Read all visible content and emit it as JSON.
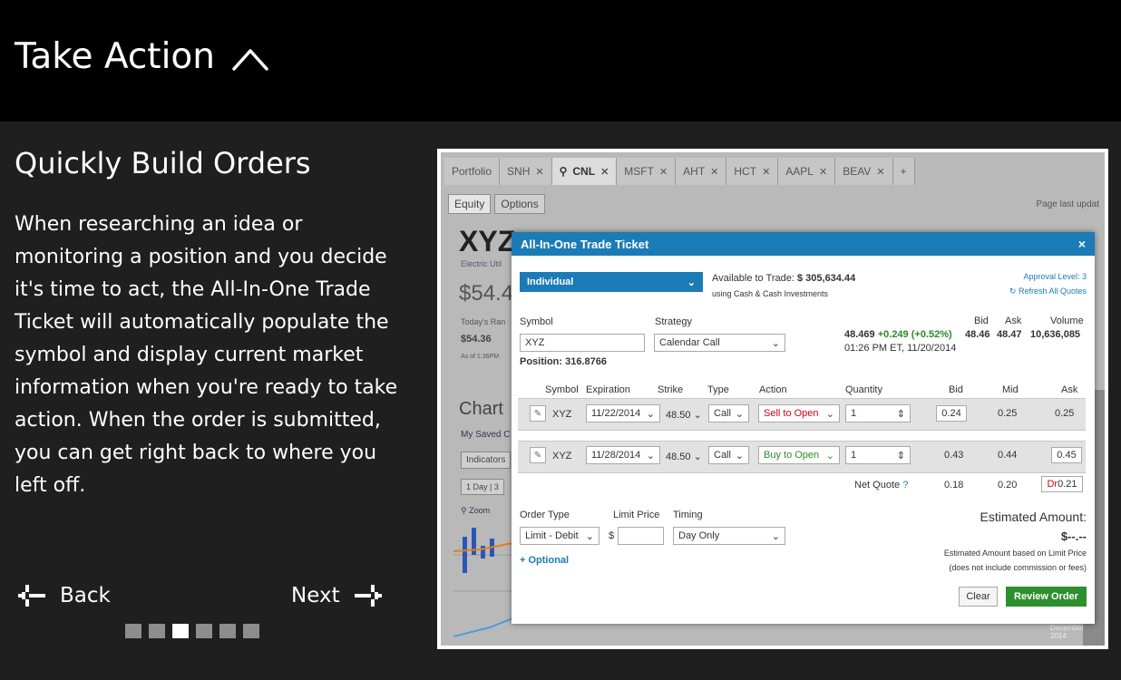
{
  "header": {
    "title": "Take Action"
  },
  "section": {
    "title": "Quickly Build Orders",
    "body": "When researching an idea or monitoring a position and you decide it's time to act, the All-In-One Trade Ticket will automatically populate the symbol and display current market information when you're ready to take action. When the order is submitted, you can get right back to where you left off."
  },
  "nav": {
    "back": "Back",
    "next": "Next",
    "page_count": 6,
    "current_page": 3
  },
  "background": {
    "tabs": [
      {
        "label": "Portfolio"
      },
      {
        "label": "SNH"
      },
      {
        "label": "CNL"
      },
      {
        "label": "MSFT"
      },
      {
        "label": "AHT"
      },
      {
        "label": "HCT"
      },
      {
        "label": "AAPL"
      },
      {
        "label": "BEAV"
      }
    ],
    "sub_tabs": [
      "Equity",
      "Options"
    ],
    "page_updated": "Page last updat",
    "symbol": "XYZ",
    "util_label": "Electric Util",
    "price": "$54.4",
    "today_label": "Today's Ran",
    "today_value": "$54.36",
    "as_of": "As of 1:36PM",
    "chart_label": "Chart",
    "my_saved": "My Saved C",
    "indicators": "Indicators",
    "one_day": "1 Day",
    "three": "3",
    "zoom": "Zoom",
    "december": "December",
    "year": "2014"
  },
  "ticket": {
    "title": "All-In-One Trade Ticket",
    "close": "×",
    "account": "Individual",
    "available_label": "Available to Trade:",
    "available_value": "$ 305,634.44",
    "using": "using Cash & Cash Investments",
    "approval": "Approval Level: 3",
    "refresh": "Refresh All Quotes",
    "symbol_label": "Symbol",
    "symbol_value": "XYZ",
    "position": "Position: 316.8766",
    "strategy_label": "Strategy",
    "strategy_value": "Calendar Call",
    "quote": {
      "last": "48.469",
      "change": "+0.249 (+0.52%)",
      "time": "01:26 PM ET, 11/20/2014",
      "bid_label": "Bid",
      "ask_label": "Ask",
      "volume_label": "Volume",
      "bid": "48.46",
      "ask": "48.47",
      "volume": "10,636,085"
    },
    "columns": [
      "Symbol",
      "Expiration",
      "Strike",
      "Type",
      "Action",
      "Quantity",
      "Bid",
      "Mid",
      "Ask"
    ],
    "legs": [
      {
        "symbol": "XYZ",
        "expiration": "11/22/2014",
        "strike": "48.50",
        "type": "Call",
        "action": "Sell to Open",
        "quantity": "1",
        "bid": "0.24",
        "mid": "0.25",
        "ask": "0.25"
      },
      {
        "symbol": "XYZ",
        "expiration": "11/28/2014",
        "strike": "48.50",
        "type": "Call",
        "action": "Buy to Open",
        "quantity": "1",
        "bid": "0.43",
        "mid": "0.44",
        "ask": "0.45"
      }
    ],
    "net_quote_label": "Net Quote",
    "net_bid": "0.18",
    "net_mid": "0.20",
    "net_ask_prefix": "Dr",
    "net_ask": "0.21",
    "order_type_label": "Order Type",
    "order_type_value": "Limit - Debit",
    "limit_price_label": "Limit Price",
    "dollar": "$",
    "timing_label": "Timing",
    "timing_value": "Day Only",
    "optional": "+ Optional",
    "estimated_label": "Estimated Amount:",
    "estimated_value": "$--.--",
    "estimated_note1": "Estimated Amount based on Limit Price",
    "estimated_note2": "(does not include commission or fees)",
    "clear": "Clear",
    "review": "Review Order"
  },
  "colors": {
    "header_bg": "#000000",
    "page_bg": "#1f1f1f",
    "ticket_blue": "#1b7bb6",
    "review_green": "#2d8f2d",
    "sell_red": "#d0021b",
    "buy_green": "#2a8a2a"
  }
}
